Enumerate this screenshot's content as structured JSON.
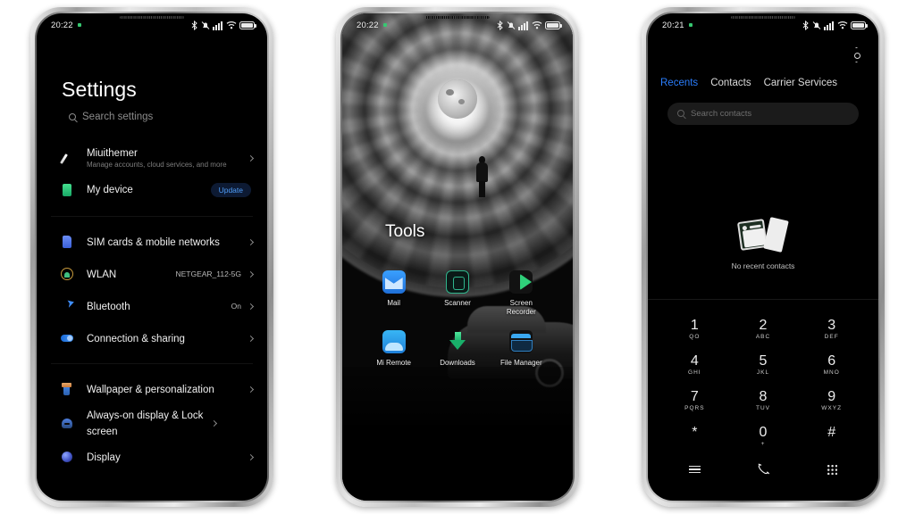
{
  "background_color": "#ffffff",
  "phones": {
    "settings": {
      "status_bar": {
        "time": "20:22",
        "icons": [
          "bluetooth-icon",
          "notifications-muted-icon",
          "signal-icon",
          "wifi-icon",
          "battery-icon"
        ]
      },
      "title": "Settings",
      "search": {
        "placeholder": "Search settings",
        "icon": "search-icon"
      },
      "groups": [
        {
          "items": [
            {
              "label": "Miuithemer",
              "sub": "Manage accounts, cloud services, and more",
              "icon": "theme-brush-icon",
              "accessory": "chevron"
            },
            {
              "label": "My device",
              "sub": "",
              "icon": "device-icon",
              "accessory": "badge",
              "badge": "Update"
            }
          ]
        },
        {
          "items": [
            {
              "label": "SIM cards & mobile networks",
              "sub": "",
              "icon": "sim-card-icon",
              "accessory": "chevron"
            },
            {
              "label": "WLAN",
              "sub": "",
              "icon": "wlan-icon",
              "value": "NETGEAR_112-5G",
              "accessory": "chevron"
            },
            {
              "label": "Bluetooth",
              "sub": "",
              "icon": "bluetooth-icon",
              "value": "On",
              "accessory": "chevron"
            },
            {
              "label": "Connection & sharing",
              "sub": "",
              "icon": "connection-sharing-icon",
              "accessory": "chevron"
            }
          ]
        },
        {
          "items": [
            {
              "label": "Wallpaper & personalization",
              "sub": "",
              "icon": "wallpaper-brush-icon",
              "accessory": "chevron"
            },
            {
              "label": "Always-on display & Lock screen",
              "sub": "",
              "icon": "lock-screen-icon",
              "accessory": "chevron"
            },
            {
              "label": "Display",
              "sub": "",
              "icon": "display-icon",
              "accessory": "chevron"
            }
          ]
        }
      ]
    },
    "home": {
      "status_bar": {
        "time": "20:22",
        "icons": [
          "bluetooth-icon",
          "notifications-muted-icon",
          "signal-icon",
          "wifi-icon",
          "battery-icon"
        ]
      },
      "folder_title": "Tools",
      "wallpaper": "monochrome-vortex-moon-figure-on-car",
      "apps": [
        {
          "label": "Mail",
          "icon": "mail-icon",
          "color": "#3aa0ff"
        },
        {
          "label": "Scanner",
          "icon": "scanner-icon",
          "color": "#2fb58c"
        },
        {
          "label": "Screen Recorder",
          "icon": "screen-recorder-icon",
          "color": "#2fd07a"
        },
        {
          "label": "Mi Remote",
          "icon": "mi-remote-icon",
          "color": "#38b6f5"
        },
        {
          "label": "Downloads",
          "icon": "downloads-icon",
          "color": "#19b06a"
        },
        {
          "label": "File Manager",
          "icon": "file-manager-icon",
          "color": "#3aa8f0"
        }
      ]
    },
    "dialer": {
      "status_bar": {
        "time": "20:21",
        "icons": [
          "bluetooth-icon",
          "notifications-muted-icon",
          "signal-icon",
          "wifi-icon",
          "battery-icon"
        ]
      },
      "settings_icon": "gear-icon",
      "tabs": [
        {
          "label": "Recents",
          "active": true
        },
        {
          "label": "Contacts",
          "active": false
        },
        {
          "label": "Carrier Services",
          "active": false
        }
      ],
      "active_tab_color": "#2a7dfc",
      "search": {
        "placeholder": "Search contacts",
        "icon": "search-icon"
      },
      "empty_state": {
        "text": "No recent contacts",
        "icon": "no-contacts-cards-icon"
      },
      "keypad": [
        {
          "digit": "1",
          "letters": "QO"
        },
        {
          "digit": "2",
          "letters": "ABC"
        },
        {
          "digit": "3",
          "letters": "DEF"
        },
        {
          "digit": "4",
          "letters": "GHI"
        },
        {
          "digit": "5",
          "letters": "JKL"
        },
        {
          "digit": "6",
          "letters": "MNO"
        },
        {
          "digit": "7",
          "letters": "PQRS"
        },
        {
          "digit": "8",
          "letters": "TUV"
        },
        {
          "digit": "9",
          "letters": "WXYZ"
        },
        {
          "digit": "*",
          "letters": ""
        },
        {
          "digit": "0",
          "letters": "+"
        },
        {
          "digit": "#",
          "letters": ""
        }
      ],
      "bottom_nav": [
        {
          "icon": "menu-icon"
        },
        {
          "icon": "call-handset-icon"
        },
        {
          "icon": "dialpad-icon"
        }
      ]
    }
  }
}
